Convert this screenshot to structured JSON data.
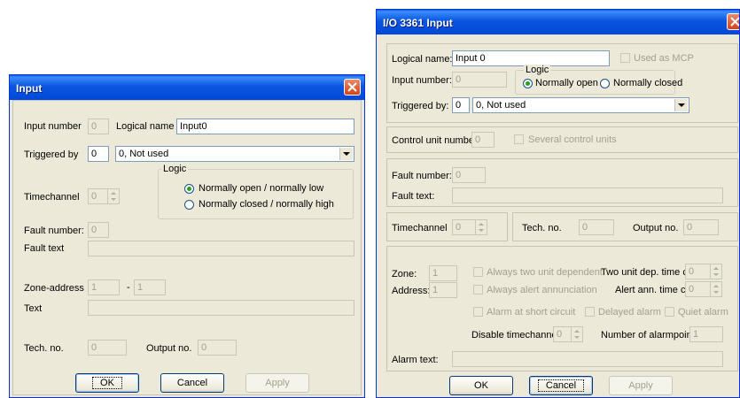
{
  "left": {
    "title": "Input",
    "input_number_label": "Input number",
    "input_number_value": "0",
    "logical_name_label": "Logical name",
    "logical_name_value": "Input0",
    "triggered_by_label": "Triggered by",
    "triggered_by_value": "0",
    "triggered_by_select": "0, Not used",
    "logic_label": "Logic",
    "logic_option_1": "Normally open / normally low",
    "logic_option_2": "Normally closed / normally high",
    "timechannel_label": "Timechannel",
    "timechannel_value": "0",
    "fault_number_label": "Fault number:",
    "fault_number_value": "0",
    "fault_text_label": "Fault text",
    "zone_address_label": "Zone-address",
    "zone_value": "1",
    "zone_sep": "-",
    "address_value": "1",
    "text_label": "Text",
    "tech_no_label": "Tech. no.",
    "tech_no_value": "0",
    "output_no_label": "Output no.",
    "output_no_value": "0",
    "ok_label": "OK",
    "cancel_label": "Cancel",
    "apply_label": "Apply"
  },
  "right": {
    "title": "I/O 3361 Input",
    "logical_name_label": "Logical name:",
    "logical_name_value": "Input 0",
    "used_as_mcp_label": "Used as MCP",
    "input_number_label": "Input number:",
    "input_number_value": "0",
    "logic_label": "Logic",
    "logic_option_1": "Normally open",
    "logic_option_2": "Normally closed",
    "triggered_by_label": "Triggered by:",
    "triggered_by_value": "0",
    "triggered_by_select": "0, Not used",
    "control_unit_label": "Control unit number",
    "control_unit_value": "0",
    "several_cu_label": "Several control units",
    "fault_number_label": "Fault number:",
    "fault_number_value": "0",
    "fault_text_label": "Fault text:",
    "timechannel_label": "Timechannel",
    "timechannel_value": "0",
    "tech_no_label": "Tech. no.",
    "tech_no_value": "0",
    "output_no_label": "Output no.",
    "output_no_value": "0",
    "zone_label": "Zone:",
    "zone_value": "1",
    "address_label": "Address:",
    "address_value": "1",
    "always_two_unit_label": "Always two unit dependent",
    "always_alert_label": "Always alert annunciation",
    "alarm_short_label": "Alarm at short circuit",
    "delayed_alarm_label": "Delayed alarm",
    "quiet_alarm_label": "Quiet alarm",
    "two_unit_time_label": "Two unit dep. time ch.",
    "two_unit_time_value": "0",
    "alert_ann_time_label": "Alert ann. time ch.",
    "alert_ann_time_value": "0",
    "disable_tc_label": "Disable timechannel",
    "disable_tc_value": "0",
    "num_alarmpoints_label": "Number of alarmpoints",
    "num_alarmpoints_value": "1",
    "alarm_text_label": "Alarm text:",
    "ok_label": "OK",
    "cancel_label": "Cancel",
    "apply_label": "Apply"
  },
  "colors": {
    "title_blue": "#0054e3",
    "close_red": "#d4431d",
    "dialog_bg": "#ece9d8",
    "disabled_text": "#a3a08d"
  },
  "icons": {
    "close": "close-x-icon",
    "dropdown": "chevron-down-icon",
    "spinner": "spin-updown-icon"
  }
}
